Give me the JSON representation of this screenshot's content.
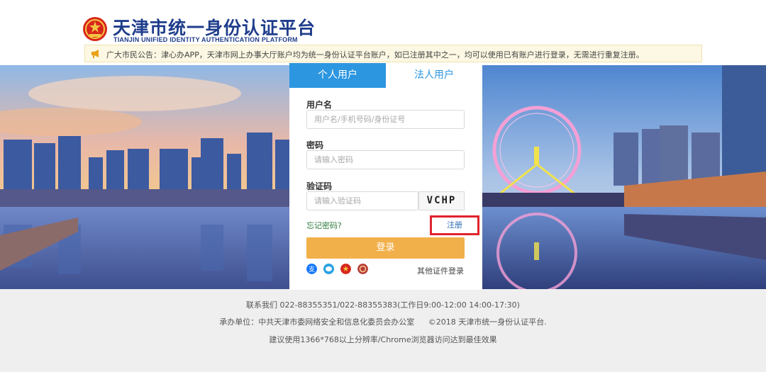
{
  "header": {
    "title": "天津市统一身份认证平台",
    "subtitle": "TIANJIN UNIFIED IDENTITY AUTHENTICATION PLATFORM",
    "notice": "广大市民公告：津心办APP，天津市网上办事大厅账户均为统一身份认证平台账户，如已注册其中之一，均可以使用已有账户进行登录，无需进行重复注册。"
  },
  "login": {
    "tabs": [
      {
        "label": "个人用户",
        "active": true
      },
      {
        "label": "法人用户",
        "active": false
      }
    ],
    "username": {
      "label": "用户名",
      "placeholder": "用户名/手机号码/身份证号",
      "value": ""
    },
    "password": {
      "label": "密码",
      "placeholder": "请输入密码",
      "value": ""
    },
    "captcha": {
      "label": "验证码",
      "placeholder": "请输入验证码",
      "value": "",
      "image_text": "VCHP"
    },
    "forgot_password": "忘记密码?",
    "register": "注册",
    "submit": "登录",
    "alt_login_icons": [
      "alipay-icon",
      "wechat-icon",
      "emblem-icon",
      "badge-icon"
    ],
    "other_login": "其他证件登录"
  },
  "footer": {
    "contact": "联系我们 022-88355351/022-88355383(工作日9:00-12:00 14:00-17:30)",
    "organizer_label": "承办单位：",
    "organizer": "中共天津市委网络安全和信息化委员会办公室",
    "copyright": "©2018 天津市统一身份认证平台.",
    "recommendation": "建议使用1366*768以上分辨率/Chrome浏览器访问达到最佳效果"
  },
  "colors": {
    "brand": "#1f3d8c",
    "tab_active": "#2d96e0",
    "login_button": "#f2b04a",
    "highlight_border": "#e0242d"
  }
}
